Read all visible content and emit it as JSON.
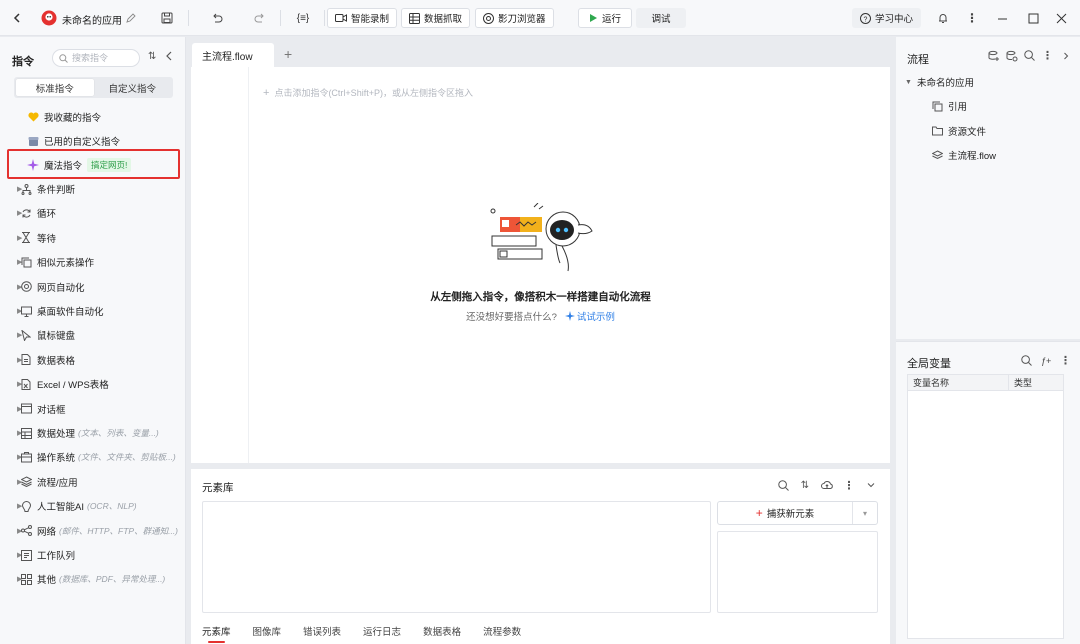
{
  "titlebar": {
    "app_name": "未命名的应用",
    "buttons": {
      "smart_record": "智能录制",
      "data_capture": "数据抓取",
      "shadow_browser": "影刀浏览器",
      "run": "运行",
      "debug": "调试",
      "learning_center": "学习中心"
    }
  },
  "left_panel": {
    "title": "指令",
    "search_placeholder": "搜索指令",
    "tabs": [
      "标准指令",
      "自定义指令"
    ],
    "top_items": [
      {
        "label": "我收藏的指令",
        "icon": "heart-icon"
      },
      {
        "label": "已用的自定义指令",
        "icon": "box-icon"
      }
    ],
    "magic": {
      "label": "魔法指令",
      "badge": "搞定网页!",
      "icon": "sparkle-icon"
    },
    "groups": [
      {
        "label": "条件判断",
        "hint": "",
        "icon": "branch-icon"
      },
      {
        "label": "循环",
        "hint": "",
        "icon": "loop-icon"
      },
      {
        "label": "等待",
        "hint": "",
        "icon": "hourglass-icon"
      },
      {
        "label": "相似元素操作",
        "hint": "",
        "icon": "copy-icon"
      },
      {
        "label": "网页自动化",
        "hint": "",
        "icon": "globe-icon"
      },
      {
        "label": "桌面软件自动化",
        "hint": "",
        "icon": "monitor-icon"
      },
      {
        "label": "鼠标键盘",
        "hint": "",
        "icon": "cursor-icon"
      },
      {
        "label": "数据表格",
        "hint": "",
        "icon": "sheet-icon"
      },
      {
        "label": "Excel / WPS表格",
        "hint": "",
        "icon": "excel-icon"
      },
      {
        "label": "对话框",
        "hint": "",
        "icon": "dialog-icon"
      },
      {
        "label": "数据处理",
        "hint": "(文本、列表、变量...)",
        "icon": "data-icon"
      },
      {
        "label": "操作系统",
        "hint": "(文件、文件夹、剪贴板...)",
        "icon": "system-icon"
      },
      {
        "label": "流程/应用",
        "hint": "",
        "icon": "layers-icon"
      },
      {
        "label": "人工智能AI",
        "hint": "(OCR、NLP)",
        "icon": "ai-icon"
      },
      {
        "label": "网络",
        "hint": "(邮件、HTTP、FTP、群通知...)",
        "icon": "network-icon"
      },
      {
        "label": "工作队列",
        "hint": "",
        "icon": "queue-icon"
      },
      {
        "label": "其他",
        "hint": "(数据库、PDF、异常处理...)",
        "icon": "grid-icon"
      }
    ]
  },
  "editor": {
    "tab_label": "主流程.flow",
    "add_hint": "点击添加指令(Ctrl+Shift+P)，或从左侧指令区拖入",
    "empty_title": "从左侧拖入指令，像搭积木一样搭建自动化流程",
    "empty_sub": "还没想好要搭点什么?",
    "example_link": "试试示例"
  },
  "element_library": {
    "title": "元素库",
    "capture_button": "捕获新元素",
    "bottom_tabs": [
      "元素库",
      "图像库",
      "错误列表",
      "运行日志",
      "数据表格",
      "流程参数"
    ]
  },
  "flow_panel": {
    "title": "流程",
    "root": "未命名的应用",
    "items": [
      {
        "label": "引用",
        "icon": "reference-icon"
      },
      {
        "label": "资源文件",
        "icon": "folder-icon"
      },
      {
        "label": "主流程.flow",
        "icon": "flow-icon"
      }
    ]
  },
  "vars_panel": {
    "title": "全局变量",
    "columns": [
      "变量名称",
      "类型"
    ]
  },
  "colors": {
    "accent_red": "#e4312f",
    "run_green": "#2fa84f",
    "link_blue": "#2f7fe6"
  }
}
